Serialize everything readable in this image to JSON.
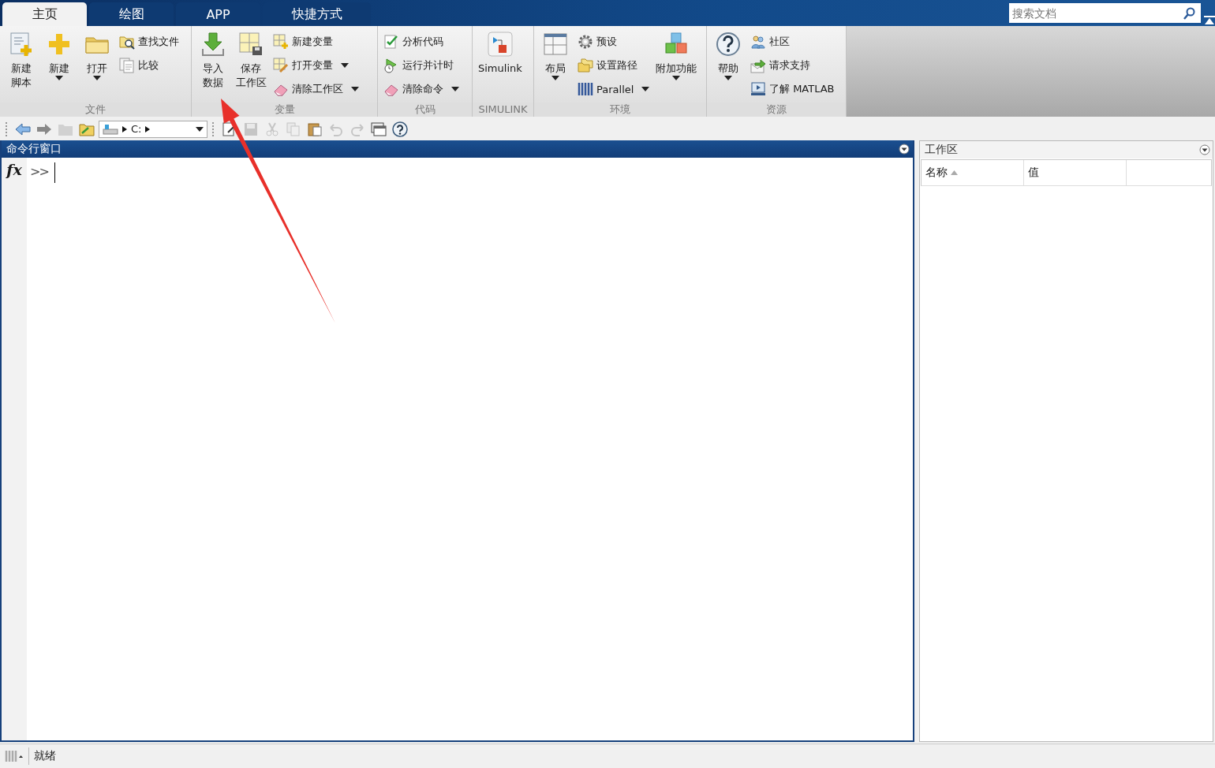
{
  "tabs": [
    {
      "label": "主页",
      "selected": true
    },
    {
      "label": "绘图",
      "selected": false
    },
    {
      "label": "APP",
      "selected": false
    },
    {
      "label": "快捷方式",
      "selected": false
    }
  ],
  "search": {
    "placeholder": "搜索文档"
  },
  "ribbon": {
    "groups": [
      {
        "title": "文件",
        "items": [
          {
            "kind": "large",
            "label": [
              "新建",
              "脚本"
            ],
            "dropdown": false
          },
          {
            "kind": "large",
            "label": [
              "新建"
            ],
            "dropdown": true
          },
          {
            "kind": "large",
            "label": [
              "打开"
            ],
            "dropdown": true
          },
          {
            "kind": "stack",
            "entries": [
              {
                "label": "查找文件",
                "dropdown": false
              },
              {
                "label": "比较",
                "dropdown": false
              }
            ]
          }
        ]
      },
      {
        "title": "变量",
        "items": [
          {
            "kind": "large",
            "label": [
              "导入",
              "数据"
            ],
            "dropdown": false
          },
          {
            "kind": "large",
            "label": [
              "保存",
              "工作区"
            ],
            "dropdown": false
          },
          {
            "kind": "stack",
            "entries": [
              {
                "label": "新建变量",
                "dropdown": false
              },
              {
                "label": "打开变量",
                "dropdown": true
              },
              {
                "label": "清除工作区",
                "dropdown": true
              }
            ]
          }
        ]
      },
      {
        "title": "代码",
        "items": [
          {
            "kind": "stack",
            "entries": [
              {
                "label": "分析代码",
                "dropdown": false
              },
              {
                "label": "运行并计时",
                "dropdown": false
              },
              {
                "label": "清除命令",
                "dropdown": true
              }
            ]
          }
        ]
      },
      {
        "title": "SIMULINK",
        "items": [
          {
            "kind": "large",
            "label": [
              "Simulink"
            ],
            "dropdown": false
          }
        ]
      },
      {
        "title": "环境",
        "items": [
          {
            "kind": "large",
            "label": [
              "布局"
            ],
            "dropdown": true
          },
          {
            "kind": "stack",
            "entries": [
              {
                "label": "预设",
                "dropdown": false
              },
              {
                "label": "设置路径",
                "dropdown": false
              },
              {
                "label": "Parallel",
                "dropdown": true
              }
            ]
          },
          {
            "kind": "large",
            "label": [
              "附加功能"
            ],
            "dropdown": true
          }
        ]
      },
      {
        "title": "资源",
        "items": [
          {
            "kind": "large",
            "label": [
              "帮助"
            ],
            "dropdown": true
          },
          {
            "kind": "stack",
            "entries": [
              {
                "label": "社区",
                "dropdown": false
              },
              {
                "label": "请求支持",
                "dropdown": false
              },
              {
                "label": "了解 MATLAB",
                "dropdown": false
              }
            ]
          }
        ]
      }
    ]
  },
  "toolbar": {
    "nav_buttons": [
      {
        "disabled": false
      },
      {
        "disabled": false
      },
      {
        "disabled": true
      },
      {
        "disabled": false
      }
    ],
    "path": {
      "segments": [
        "C:"
      ]
    },
    "file_buttons": [
      {
        "disabled": false
      },
      {
        "disabled": true
      },
      {
        "disabled": true
      },
      {
        "disabled": true
      },
      {
        "disabled": false
      },
      {
        "disabled": true
      },
      {
        "disabled": true
      },
      {
        "disabled": false
      },
      {
        "disabled": false
      }
    ]
  },
  "command_window": {
    "title": "命令行窗口",
    "fx": "fx",
    "prompt": ">>"
  },
  "workspace": {
    "title": "工作区",
    "columns": [
      {
        "label": "名称",
        "sorted": true
      },
      {
        "label": "值",
        "sorted": false
      }
    ]
  },
  "status_bar": {
    "text": "就绪"
  },
  "annotations": [
    {
      "kind": "arrow"
    }
  ]
}
